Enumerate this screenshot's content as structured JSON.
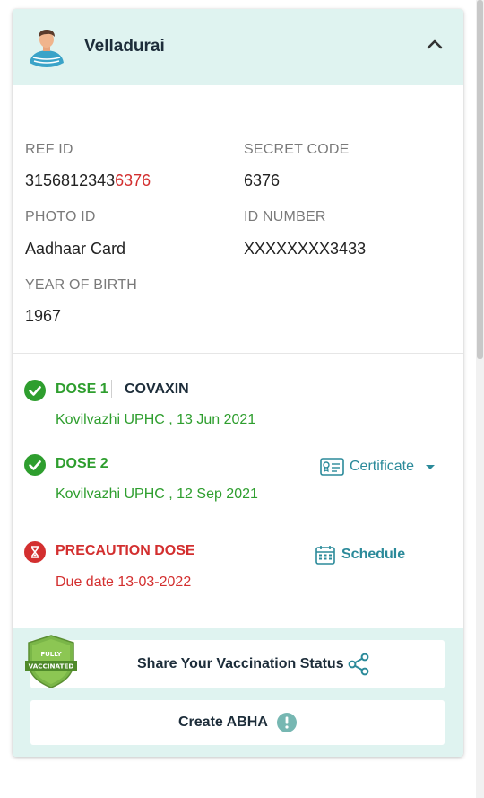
{
  "beneficiary": {
    "name": "Velladurai"
  },
  "details": {
    "ref_id_label": "REF ID",
    "ref_id_prefix": "3156812343",
    "ref_id_suffix": "6376",
    "secret_code_label": "SECRET CODE",
    "secret_code": "6376",
    "photo_id_label": "PHOTO ID",
    "photo_id": "Aadhaar Card",
    "id_number_label": "ID NUMBER",
    "id_number": "XXXXXXXX3433",
    "yob_label": "YEAR OF BIRTH",
    "yob": "1967"
  },
  "doses": {
    "dose1": {
      "title": "DOSE 1",
      "vaccine": "COVAXIN",
      "details": "Kovilvazhi UPHC , 13 Jun 2021"
    },
    "dose2": {
      "title": "DOSE 2",
      "details": "Kovilvazhi UPHC , 12 Sep 2021",
      "certificate_label": "Certificate"
    },
    "precaution": {
      "title": "PRECAUTION DOSE",
      "due": "Due date 13-03-2022",
      "schedule_label": "Schedule"
    }
  },
  "footer": {
    "badge_line1": "FULLY",
    "badge_line2": "VACCINATED",
    "share_label": "Share Your Vaccination Status",
    "abha_label": "Create ABHA"
  },
  "colors": {
    "header_bg": "#dff3f0",
    "success": "#2e9e2e",
    "danger": "#d32f2f",
    "accent": "#2b8a9a"
  },
  "icons": [
    "avatar",
    "chevron-up-icon",
    "check-circle-icon",
    "hourglass-icon",
    "certificate-icon",
    "caret-down-icon",
    "calendar-icon",
    "fully-vaccinated-badge",
    "share-icon",
    "info-icon"
  ]
}
